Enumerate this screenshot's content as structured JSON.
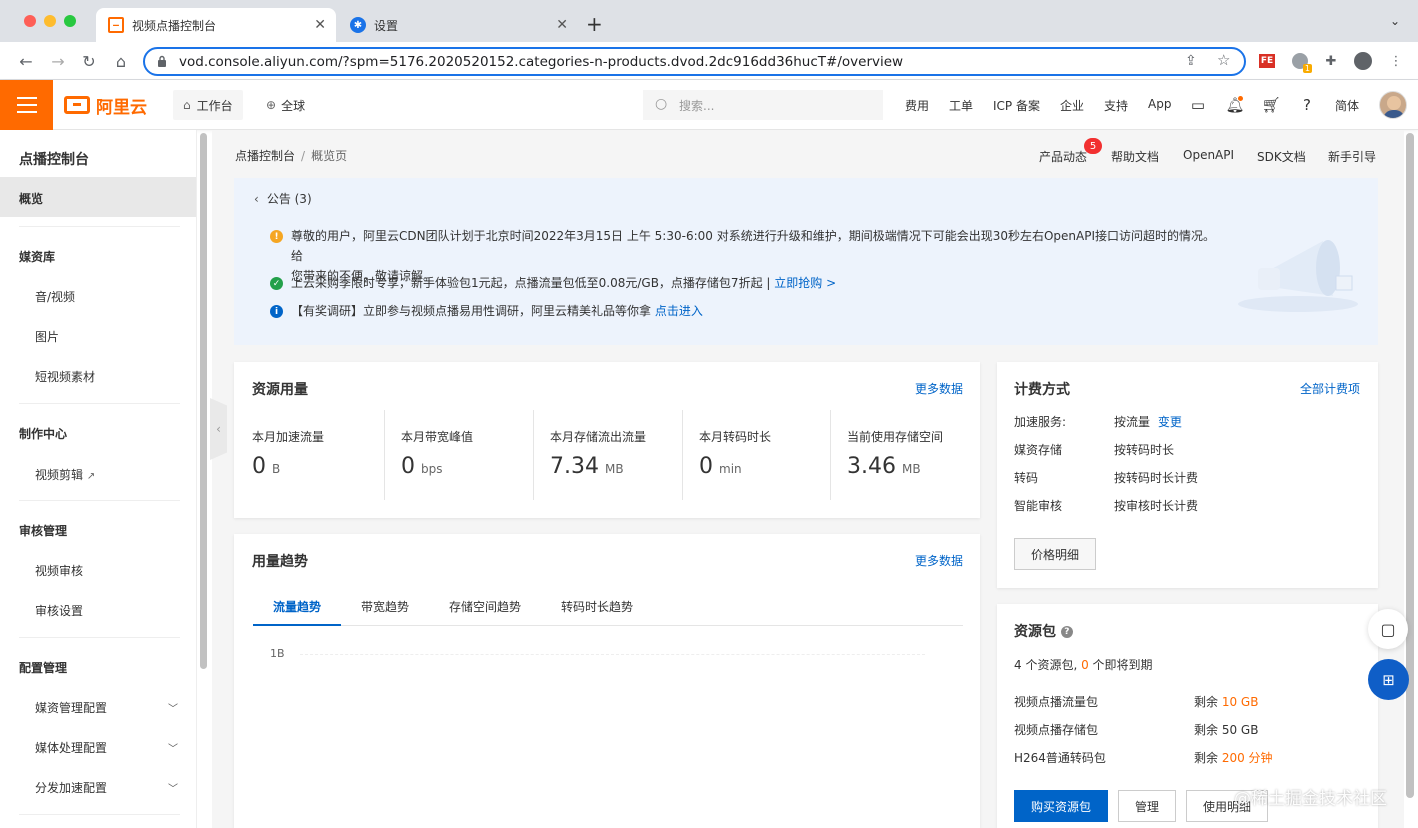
{
  "browser": {
    "tabs": [
      {
        "title": "视频点播控制台",
        "active": true
      },
      {
        "title": "设置",
        "active": false
      }
    ],
    "url": "vod.console.aliyun.com/?spm=5176.2020520152.categories-n-products.dvod.2dc916dd36hucT#/overview",
    "new_tab": "+",
    "ext_badge": "1",
    "fe_label": "FE"
  },
  "topnav": {
    "logo": "阿里云",
    "workbench": "工作台",
    "region": "全球",
    "search_placeholder": "搜索...",
    "links": [
      "费用",
      "工单",
      "ICP 备案",
      "企业",
      "支持",
      "App"
    ],
    "lang": "简体"
  },
  "sidebar": {
    "title": "点播控制台",
    "active": "概览",
    "groups": [
      {
        "title": "媒资库",
        "items": [
          "音/视频",
          "图片",
          "短视频素材"
        ]
      },
      {
        "title": "制作中心",
        "items": [
          "视频剪辑"
        ]
      },
      {
        "title": "审核管理",
        "items": [
          "视频审核",
          "审核设置"
        ]
      },
      {
        "title": "配置管理",
        "items": [
          "媒资管理配置",
          "媒体处理配置",
          "分发加速配置"
        ]
      }
    ]
  },
  "header": {
    "breadcrumb": [
      "点播控制台",
      "概览页"
    ],
    "breadcrumb_sep": "/",
    "links": [
      "产品动态",
      "帮助文档",
      "OpenAPI",
      "SDK文档",
      "新手引导"
    ],
    "badge": "5"
  },
  "notice": {
    "title": "公告 (3)",
    "items": [
      {
        "type": "warning",
        "text": "尊敬的用户，阿里云CDN团队计划于北京时间2022年3月15日 上午 5:30-6:00 对系统进行升级和维护，期间极端情况下可能会出现30秒左右OpenAPI接口访问超时的情况。给",
        "text2": "您带来的不便，敬请谅解。"
      },
      {
        "type": "success",
        "text": "上云采购季限时专享，新手体验包1元起，点播流量包低至0.08元/GB，点播存储包7折起 | ",
        "link": "立即抢购 >"
      },
      {
        "type": "info",
        "text": "【有奖调研】立即参与视频点播易用性调研，阿里云精美礼品等你拿 ",
        "link": "点击进入"
      }
    ]
  },
  "usage": {
    "title": "资源用量",
    "more": "更多数据",
    "metrics": [
      {
        "label": "本月加速流量",
        "value": "0",
        "unit": "B"
      },
      {
        "label": "本月带宽峰值",
        "value": "0",
        "unit": "bps"
      },
      {
        "label": "本月存储流出流量",
        "value": "7.34",
        "unit": "MB"
      },
      {
        "label": "本月转码时长",
        "value": "0",
        "unit": "min"
      },
      {
        "label": "当前使用存储空间",
        "value": "3.46",
        "unit": "MB"
      }
    ]
  },
  "trend": {
    "title": "用量趋势",
    "more": "更多数据",
    "tabs": [
      "流量趋势",
      "带宽趋势",
      "存储空间趋势",
      "转码时长趋势"
    ],
    "active_tab": "流量趋势",
    "y_tick": "1B"
  },
  "billing": {
    "title": "计费方式",
    "all_link": "全部计费项",
    "rows": [
      {
        "key": "加速服务:",
        "value": "按流量",
        "action": "变更"
      },
      {
        "key": "媒资存储",
        "value": "按转码时长"
      },
      {
        "key": "转码",
        "value": "按转码时长计费"
      },
      {
        "key": "智能审核",
        "value": "按审核时长计费"
      }
    ],
    "price_button": "价格明细"
  },
  "packages": {
    "title": "资源包",
    "summary_pre": "4 个资源包, ",
    "summary_num": "0",
    "summary_post": " 个即将到期",
    "rows": [
      {
        "name": "视频点播流量包",
        "remain_pre": "剩余 ",
        "remain": "10 GB",
        "highlight": true
      },
      {
        "name": "视频点播存储包",
        "remain_pre": "剩余 ",
        "remain": "50 GB",
        "highlight": false
      },
      {
        "name": "H264普通转码包",
        "remain_pre": "剩余 ",
        "remain": "200 分钟",
        "highlight": true
      }
    ],
    "buy_button": "购买资源包",
    "manage_button": "管理",
    "usage_button": "使用明细"
  },
  "watermark": "@稀土掘金技术社区",
  "colors": {
    "accent": "#ff6a00",
    "link": "#0064c8",
    "notice_bg": "#edf3fc"
  }
}
